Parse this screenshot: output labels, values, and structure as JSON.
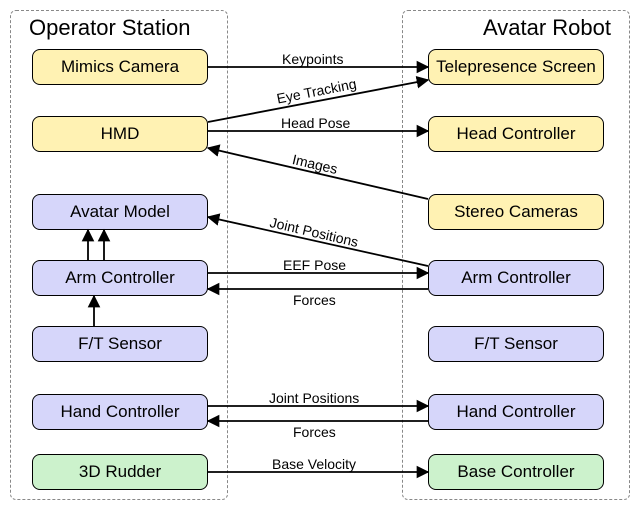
{
  "groups": {
    "left": {
      "title": "Operator Station"
    },
    "right": {
      "title": "Avatar Robot"
    }
  },
  "nodes": {
    "mimics_camera": "Mimics Camera",
    "hmd": "HMD",
    "avatar_model": "Avatar Model",
    "arm_controller_left": "Arm Controller",
    "ft_sensor_left": "F/T Sensor",
    "hand_controller_left": "Hand Controller",
    "rudder": "3D Rudder",
    "telepresence": "Telepresence Screen",
    "head_controller": "Head Controller",
    "stereo_cameras": "Stereo Cameras",
    "arm_controller_right": "Arm Controller",
    "ft_sensor_right": "F/T Sensor",
    "hand_controller_right": "Hand Controller",
    "base_controller": "Base Controller"
  },
  "edges": {
    "keypoints": "Keypoints",
    "eye_tracking": "Eye Tracking",
    "head_pose": "Head Pose",
    "images": "Images",
    "joint_positions1": "Joint Positions",
    "eef_pose": "EEF Pose",
    "forces1": "Forces",
    "joint_positions2": "Joint Positions",
    "forces2": "Forces",
    "base_velocity": "Base Velocity"
  },
  "chart_data": {
    "type": "diagram",
    "title": "",
    "groups": [
      {
        "id": "operator_station",
        "label": "Operator Station"
      },
      {
        "id": "avatar_robot",
        "label": "Avatar Robot"
      }
    ],
    "nodes": [
      {
        "id": "mimics_camera",
        "group": "operator_station",
        "label": "Mimics Camera",
        "color": "yellow"
      },
      {
        "id": "hmd",
        "group": "operator_station",
        "label": "HMD",
        "color": "yellow"
      },
      {
        "id": "avatar_model",
        "group": "operator_station",
        "label": "Avatar Model",
        "color": "purple"
      },
      {
        "id": "arm_controller_left",
        "group": "operator_station",
        "label": "Arm Controller",
        "color": "purple"
      },
      {
        "id": "ft_sensor_left",
        "group": "operator_station",
        "label": "F/T Sensor",
        "color": "purple"
      },
      {
        "id": "hand_controller_left",
        "group": "operator_station",
        "label": "Hand Controller",
        "color": "purple"
      },
      {
        "id": "rudder",
        "group": "operator_station",
        "label": "3D Rudder",
        "color": "green"
      },
      {
        "id": "telepresence",
        "group": "avatar_robot",
        "label": "Telepresence Screen",
        "color": "yellow"
      },
      {
        "id": "head_controller",
        "group": "avatar_robot",
        "label": "Head Controller",
        "color": "yellow"
      },
      {
        "id": "stereo_cameras",
        "group": "avatar_robot",
        "label": "Stereo Cameras",
        "color": "yellow"
      },
      {
        "id": "arm_controller_right",
        "group": "avatar_robot",
        "label": "Arm Controller",
        "color": "purple"
      },
      {
        "id": "ft_sensor_right",
        "group": "avatar_robot",
        "label": "F/T Sensor",
        "color": "purple"
      },
      {
        "id": "hand_controller_right",
        "group": "avatar_robot",
        "label": "Hand Controller",
        "color": "purple"
      },
      {
        "id": "base_controller",
        "group": "avatar_robot",
        "label": "Base Controller",
        "color": "green"
      }
    ],
    "edges": [
      {
        "from": "mimics_camera",
        "to": "telepresence",
        "label": "Keypoints",
        "direction": "forward"
      },
      {
        "from": "hmd",
        "to": "telepresence",
        "label": "Eye Tracking",
        "direction": "forward"
      },
      {
        "from": "hmd",
        "to": "head_controller",
        "label": "Head Pose",
        "direction": "forward"
      },
      {
        "from": "stereo_cameras",
        "to": "hmd",
        "label": "Images",
        "direction": "forward"
      },
      {
        "from": "arm_controller_right",
        "to": "avatar_model",
        "label": "Joint Positions",
        "direction": "forward"
      },
      {
        "from": "arm_controller_left",
        "to": "arm_controller_right",
        "label": "EEF Pose",
        "direction": "forward"
      },
      {
        "from": "arm_controller_right",
        "to": "arm_controller_left",
        "label": "Forces",
        "direction": "forward"
      },
      {
        "from": "ft_sensor_left",
        "to": "arm_controller_left",
        "label": "",
        "direction": "forward"
      },
      {
        "from": "arm_controller_left",
        "to": "avatar_model",
        "label": "",
        "direction": "forward"
      },
      {
        "from": "hand_controller_left",
        "to": "hand_controller_right",
        "label": "Joint Positions",
        "direction": "forward"
      },
      {
        "from": "hand_controller_right",
        "to": "hand_controller_left",
        "label": "Forces",
        "direction": "forward"
      },
      {
        "from": "rudder",
        "to": "base_controller",
        "label": "Base Velocity",
        "direction": "forward"
      }
    ]
  }
}
